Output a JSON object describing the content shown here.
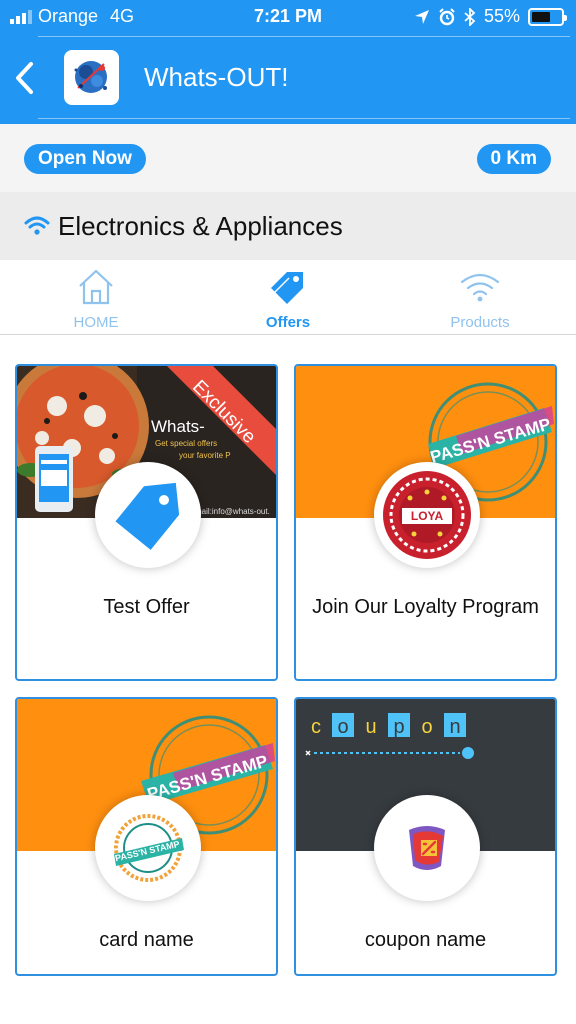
{
  "status_bar": {
    "carrier": "Orange",
    "network": "4G",
    "time": "7:21 PM",
    "battery": "55%",
    "icons": [
      "signal-icon",
      "location-arrow-icon",
      "alarm-icon",
      "bluetooth-icon",
      "battery-icon"
    ]
  },
  "header": {
    "title": "Whats-OUT!",
    "back_icon": "chevron-left-icon",
    "logo": "app-logo"
  },
  "info": {
    "open_status": "Open Now",
    "distance": "0 Km"
  },
  "category": {
    "icon": "wifi-icon",
    "label": "Electronics & Appliances"
  },
  "tabs": [
    {
      "label": "HOME",
      "icon": "house-icon",
      "active": false
    },
    {
      "label": "Offers",
      "icon": "tag-icon",
      "active": true
    },
    {
      "label": "Products",
      "icon": "wifi-icon",
      "active": false
    }
  ],
  "cards": [
    {
      "title": "Test Offer",
      "banner_text": "Whats-",
      "banner_sub1": "Get special offers",
      "banner_sub2": "your favorite P",
      "banner_email": "mail:info@whats-out.",
      "ribbon": "Exclusive"
    },
    {
      "title": "Join Our Loyalty Program",
      "stamp_text": "PASS'N STAMP",
      "badge_text": "LOYA"
    },
    {
      "title": "card name",
      "stamp_text": "PASS'N STAMP",
      "badge_text": "PASS'N STAMP"
    },
    {
      "title": "coupon name",
      "coupon_letters": [
        "c",
        "o",
        "u",
        "p",
        "o",
        "n"
      ]
    }
  ],
  "colors": {
    "primary": "#2196F3",
    "orange": "#FF8F0F",
    "dark": "#3a3f44",
    "ribbon_red": "#E84C3D"
  }
}
